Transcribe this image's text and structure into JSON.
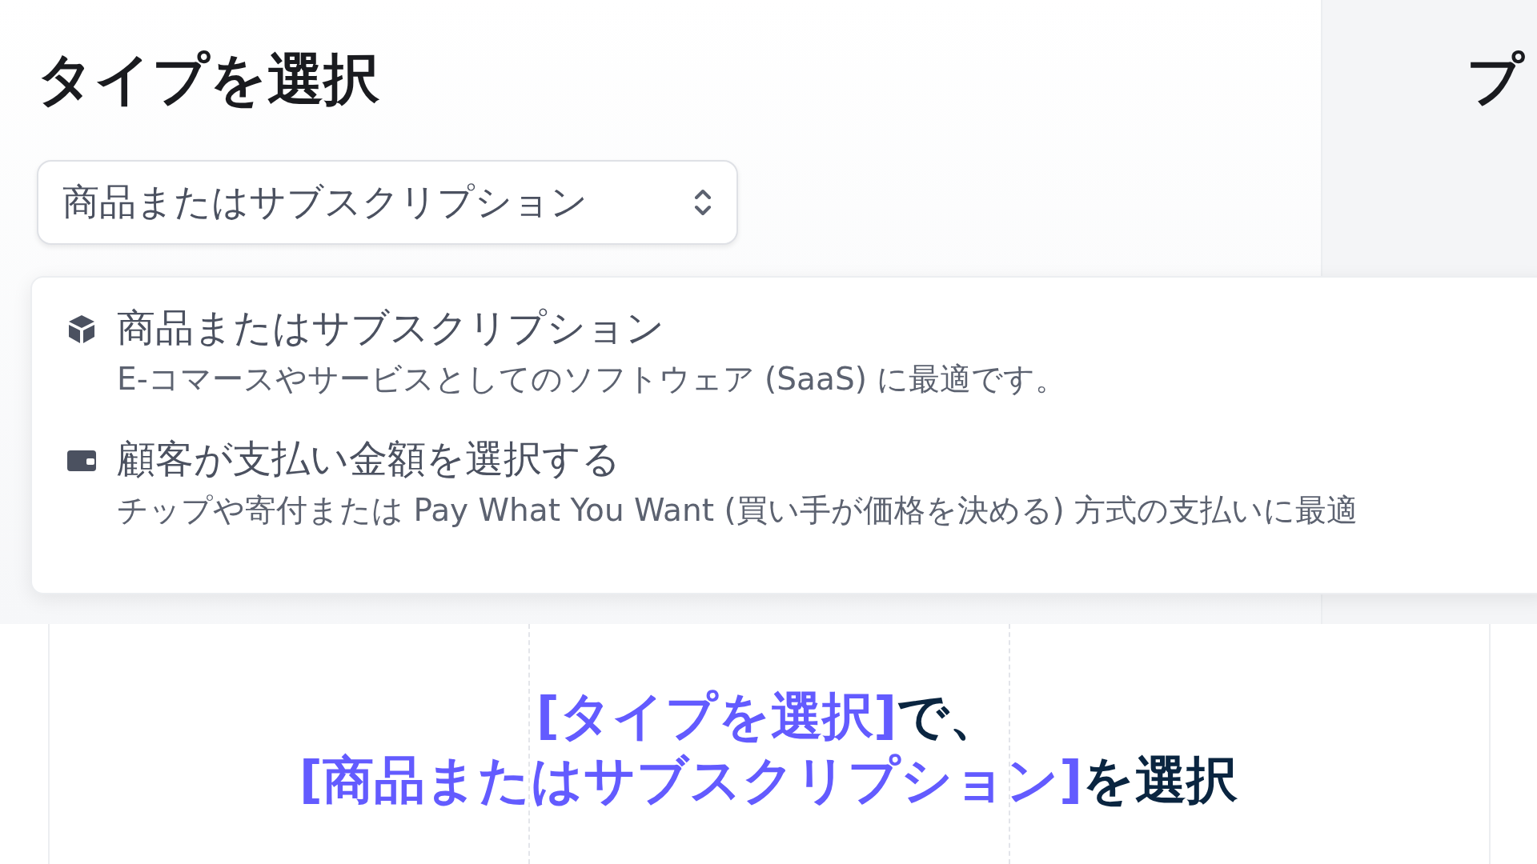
{
  "type_panel": {
    "title": "タイプを選択",
    "select": {
      "value": "商品またはサブスクリプション"
    },
    "options": [
      {
        "kind": "product",
        "label": "商品またはサブスクリプション",
        "description": "E-コマースやサービスとしてのソフトウェア (SaaS) に最適です。"
      },
      {
        "kind": "wallet",
        "label": "顧客が支払い金額を選択する",
        "description": "チップや寄付または Pay What You Want (買い手が価格を決める) 方式の支払いに最適"
      }
    ]
  },
  "next_panel": {
    "title": "プ"
  },
  "caption": {
    "lines": [
      [
        {
          "text": "[タイプを選択]",
          "highlight": true
        },
        {
          "text": "で、",
          "highlight": false
        }
      ],
      [
        {
          "text": "[商品またはサブスクリプション]",
          "highlight": true
        },
        {
          "text": "を選択",
          "highlight": false
        }
      ]
    ]
  }
}
